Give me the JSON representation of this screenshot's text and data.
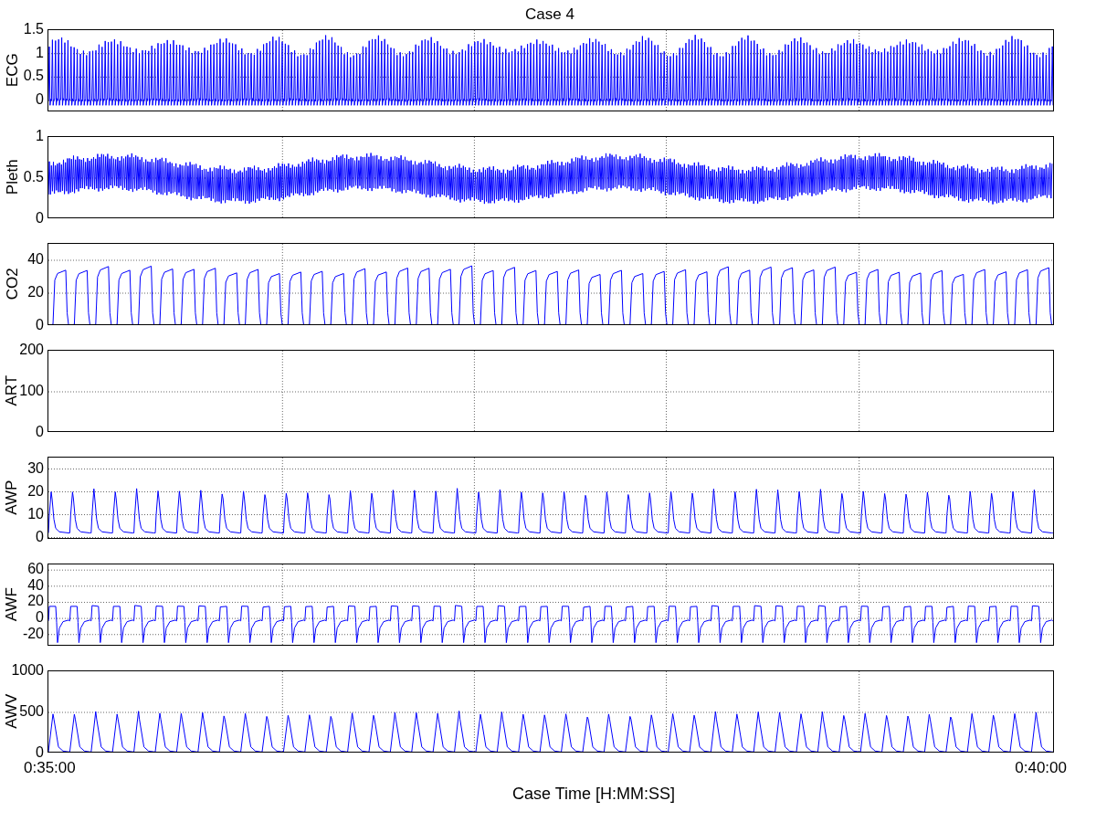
{
  "title": "Case 4",
  "panels": [
    {
      "ylabel": "ECG",
      "kind": "ecg",
      "yticks": [
        "1.5",
        "1",
        "0.5",
        "0"
      ]
    },
    {
      "ylabel": "Pleth",
      "kind": "pleth",
      "yticks": [
        "1",
        "0.5",
        "0"
      ]
    },
    {
      "ylabel": "CO2",
      "kind": "co2",
      "yticks": [
        "40",
        "20",
        "0"
      ]
    },
    {
      "ylabel": "ART",
      "kind": "art",
      "yticks": [
        "200",
        "100",
        "0"
      ]
    },
    {
      "ylabel": "AWP",
      "kind": "awp",
      "yticks": [
        "30",
        "20",
        "10",
        "0"
      ]
    },
    {
      "ylabel": "AWF",
      "kind": "awf",
      "yticks": [
        "60",
        "40",
        "20",
        "0",
        "-20"
      ]
    },
    {
      "ylabel": "AWV",
      "kind": "awv",
      "yticks": [
        "1000",
        "500",
        "0"
      ]
    }
  ],
  "xticks": [
    "0:35:00",
    "0:40:00"
  ],
  "xlabel": "Case Time [H:MM:SS]"
}
